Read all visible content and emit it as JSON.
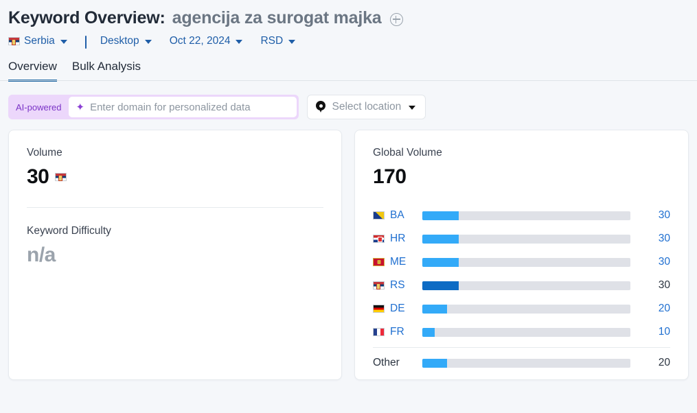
{
  "header": {
    "title_prefix": "Keyword Overview:",
    "keyword": "agencija za surogat majka",
    "add_icon": "plus-circle-icon",
    "filters": [
      {
        "label": "Serbia",
        "icon": "flag-rs-icon"
      },
      {
        "label": "Desktop",
        "icon": "monitor-icon"
      },
      {
        "label": "Oct 22, 2024",
        "icon": ""
      },
      {
        "label": "RSD",
        "icon": ""
      }
    ]
  },
  "tabs": [
    {
      "label": "Overview",
      "active": true
    },
    {
      "label": "Bulk Analysis",
      "active": false
    }
  ],
  "filter_bar": {
    "ai_badge": "AI-powered",
    "domain_placeholder": "Enter domain for personalized data",
    "domain_value": "",
    "sparkle_icon": "sparkle-icon",
    "location_label": "Select location",
    "location_icon": "map-pin-icon"
  },
  "left_card": {
    "volume_label": "Volume",
    "volume_value": "30",
    "volume_flag": "flag-rs-icon",
    "kd_label": "Keyword Difficulty",
    "kd_value": "n/a"
  },
  "right_card": {
    "global_label": "Global Volume",
    "global_value": "170"
  },
  "colors": {
    "bar_fill": "#33aaf8",
    "bar_fill_current": "#0d6bc4",
    "bar_track": "#dfe1e7",
    "link": "#1f6fd0",
    "tab_active": "#15619f",
    "ai_badge_bg": "#ecd7fb",
    "ai_badge_text": "#7b34c7"
  },
  "chart_data": {
    "type": "bar",
    "title": "Global Volume",
    "total": 170,
    "xlabel": "",
    "ylabel": "",
    "xlim": [
      0,
      170
    ],
    "grid": false,
    "legend": "none",
    "categories": [
      "BA",
      "HR",
      "ME",
      "RS",
      "DE",
      "FR",
      "Other"
    ],
    "values": [
      30,
      30,
      30,
      30,
      20,
      10,
      20
    ],
    "flags": [
      "flag-ba-icon",
      "flag-hr-icon",
      "flag-me-icon",
      "flag-rs-icon",
      "flag-de-icon",
      "flag-fr-icon",
      null
    ],
    "rows": [
      {
        "code": "BA",
        "flag": "flag-ba",
        "value": "30",
        "pct": 17.6,
        "current": false,
        "link": true
      },
      {
        "code": "HR",
        "flag": "flag-hr",
        "value": "30",
        "pct": 17.6,
        "current": false,
        "link": true
      },
      {
        "code": "ME",
        "flag": "flag-me",
        "value": "30",
        "pct": 17.6,
        "current": false,
        "link": true
      },
      {
        "code": "RS",
        "flag": "flag-rs",
        "value": "30",
        "pct": 17.6,
        "current": true,
        "link": true
      },
      {
        "code": "DE",
        "flag": "flag-de",
        "value": "20",
        "pct": 11.8,
        "current": false,
        "link": true
      },
      {
        "code": "FR",
        "flag": "flag-fr",
        "value": "10",
        "pct": 5.9,
        "current": false,
        "link": true
      }
    ],
    "other_row": {
      "code": "Other",
      "flag": null,
      "value": "20",
      "pct": 11.8,
      "current": false,
      "link": false
    }
  }
}
